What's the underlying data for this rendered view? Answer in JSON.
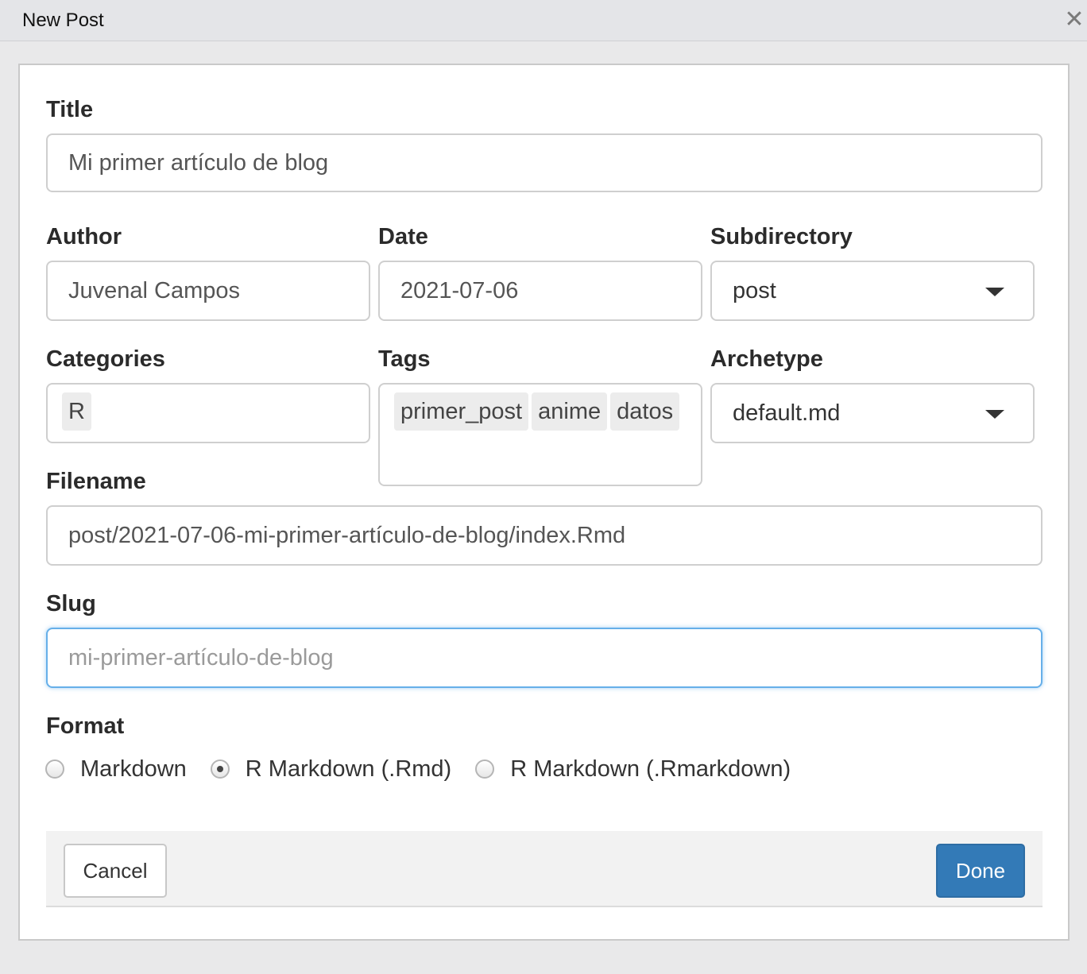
{
  "window": {
    "title": "New Post",
    "close_glyph": "✕"
  },
  "form": {
    "title": {
      "label": "Title",
      "value": "Mi primer artículo de blog"
    },
    "author": {
      "label": "Author",
      "value": "Juvenal Campos"
    },
    "date": {
      "label": "Date",
      "value": "2021-07-06"
    },
    "subdirectory": {
      "label": "Subdirectory",
      "value": "post"
    },
    "categories": {
      "label": "Categories",
      "items": [
        "R"
      ]
    },
    "tags": {
      "label": "Tags",
      "items": [
        "primer_post",
        "anime",
        "datos"
      ]
    },
    "archetype": {
      "label": "Archetype",
      "value": "default.md"
    },
    "filename": {
      "label": "Filename",
      "value": "post/2021-07-06-mi-primer-artículo-de-blog/index.Rmd"
    },
    "slug": {
      "label": "Slug",
      "placeholder": "mi-primer-artículo-de-blog"
    },
    "format": {
      "label": "Format",
      "options": [
        "Markdown",
        "R Markdown (.Rmd)",
        "R Markdown (.Rmarkdown)"
      ],
      "selected": "R Markdown (.Rmd)"
    }
  },
  "footer": {
    "cancel_label": "Cancel",
    "done_label": "Done"
  },
  "colors": {
    "primary": "#337ab7",
    "focus": "#66afe9"
  },
  "icons": {
    "close": "close-icon",
    "caret": "caret-down-icon"
  }
}
